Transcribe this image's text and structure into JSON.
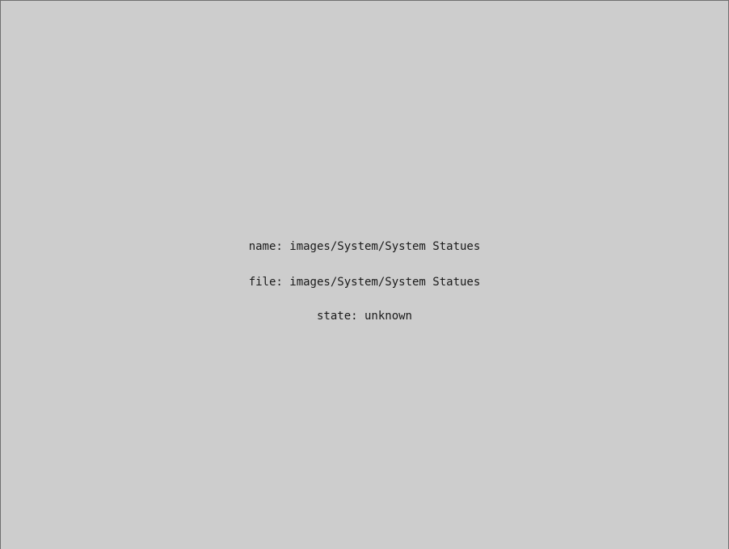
{
  "placeholder": {
    "name_text": "name: images/System/System Statues",
    "file_text": "file: images/System/System Statues",
    "state_text": "state: unknown"
  },
  "colors": {
    "panel_background": "#cdcdcd",
    "panel_border": "#6f6f6f",
    "text": "#1a1a1a"
  }
}
